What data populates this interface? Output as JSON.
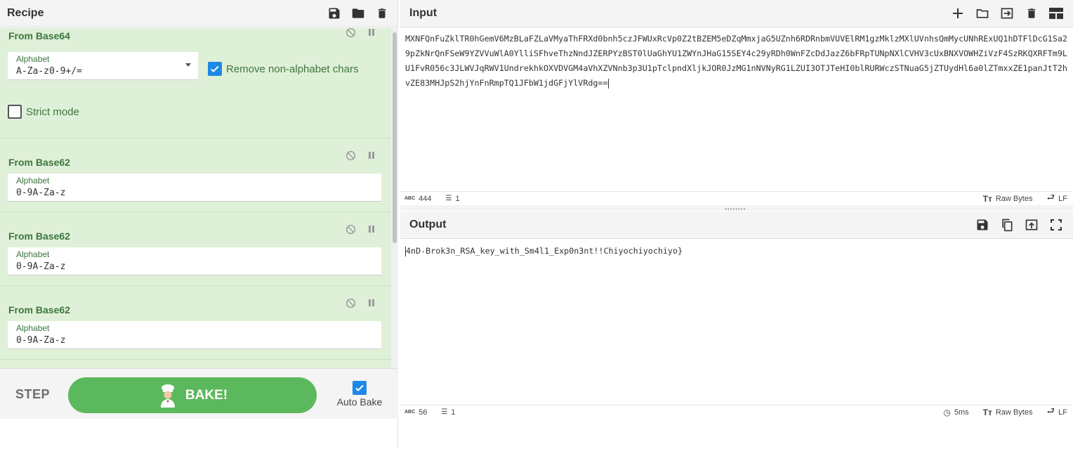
{
  "recipe": {
    "title": "Recipe",
    "header_icons": [
      "save-icon",
      "folder-icon",
      "trash-icon"
    ],
    "operations": [
      {
        "name": "From Base64",
        "alphabet_label": "Alphabet",
        "alphabet_value": "A-Za-z0-9+/=",
        "remove_nonalpha_label": "Remove non-alphabet chars",
        "remove_nonalpha_checked": true,
        "strict_label": "Strict mode",
        "strict_checked": false
      },
      {
        "name": "From Base62",
        "alphabet_label": "Alphabet",
        "alphabet_value": "0-9A-Za-z"
      },
      {
        "name": "From Base62",
        "alphabet_label": "Alphabet",
        "alphabet_value": "0-9A-Za-z"
      },
      {
        "name": "From Base62",
        "alphabet_label": "Alphabet",
        "alphabet_value": "0-9A-Za-z"
      }
    ],
    "controls": {
      "step_label": "STEP",
      "bake_label": "BAKE!",
      "autobake_label": "Auto Bake",
      "autobake_checked": true
    }
  },
  "input": {
    "title": "Input",
    "header_icons": [
      "plus-icon",
      "open-folder-icon",
      "import-icon",
      "trash-icon",
      "layout-icon"
    ],
    "text": "MXNFQnFuZklTR0hGemV6MzBLaFZLaVMyaThFRXd0bnh5czJFWUxRcVp0Z2tBZEM5eDZqMmxjaG5UZnh6RDRnbmVUVElRM1gzMklzMXlUVnhsQmMycUNhRExUQ1hDTFlDcG1Sa29pZkNrQnFSeW9YZVVuWlA0YlliSFhveThzNndJZERPYzBST0lUaGhYU1ZWYnJHaG15SEY4c29yRDh0WnFZcDdJazZ6bFRpTUNpNXlCVHV3cUxBNXVOWHZiVzF4SzRKQXRFTm9LU1FvR056c3JLWVJqRWV1UndrekhkOXVDVGM4aVhXZVNnb3p3U1pTclpndXljkJOR0JzMG1nNVNyRG1LZUI3OTJTeHI0blRURWczSTNuaG5jZTUydHl6a0lZTmxxZE1panJtT2hvZE83MHJpS2hjYnFnRmpTQ1JFbW1jdGFjYlVRdg==",
    "status": {
      "length": "444",
      "lines": "1",
      "encoding": "Raw Bytes",
      "eol": "LF"
    }
  },
  "output": {
    "title": "Output",
    "header_icons": [
      "save-icon",
      "copy-icon",
      "replace-input-icon",
      "maximize-icon"
    ],
    "text": "4nD-Brok3n_RSA_key_with_Sm4l1_Exp0n3nt!!Chiyochiyochiyo}",
    "status": {
      "length": "56",
      "lines": "1",
      "time": "5ms",
      "encoding": "Raw Bytes",
      "eol": "LF"
    }
  }
}
